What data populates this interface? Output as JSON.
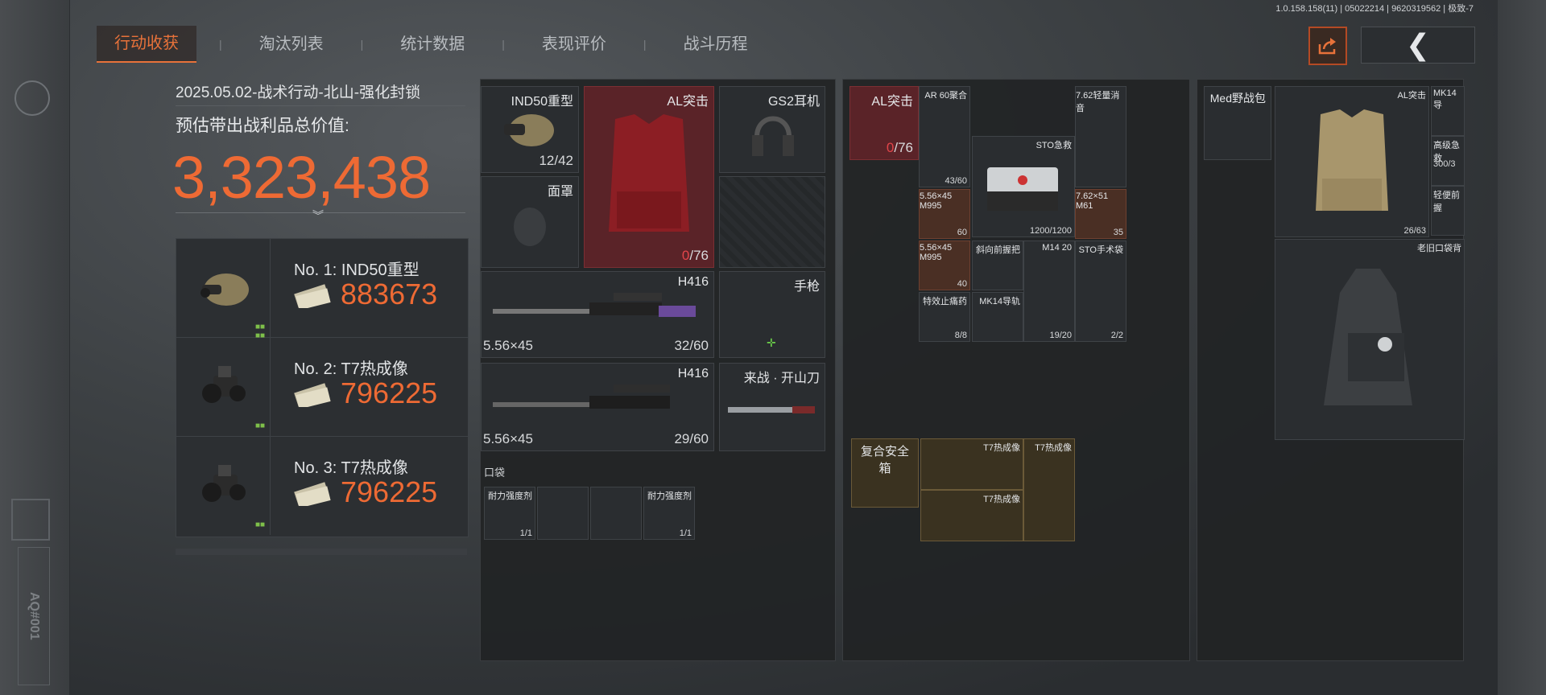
{
  "version_text": "1.0.158.158(11) | 05022214 | 9620319562 | 极致-7",
  "tabs": [
    {
      "label": "行动收获",
      "active": true
    },
    {
      "label": "淘汰列表",
      "active": false
    },
    {
      "label": "统计数据",
      "active": false
    },
    {
      "label": "表现评价",
      "active": false
    },
    {
      "label": "战斗历程",
      "active": false
    }
  ],
  "raid": {
    "info": "2025.05.02-战术行动-北山-强化封锁",
    "value_label": "预估带出战利品总价值:",
    "total_value": "3,323,438"
  },
  "top_items": [
    {
      "rank": "No. 1: IND50重型",
      "price": "883673",
      "icon": "helmet-icon"
    },
    {
      "rank": "No. 2: T7热成像",
      "price": "796225",
      "icon": "thermal-scope-icon"
    },
    {
      "rank": "No. 3: T7热成像",
      "price": "796225",
      "icon": "thermal-scope-icon"
    }
  ],
  "side_code": "AQ#001",
  "gear": {
    "helmet": {
      "label": "IND50重型",
      "count": "12/42"
    },
    "armor": {
      "label": "AL突击",
      "count_a": "0",
      "count_b": "/76"
    },
    "headset": {
      "label": "GS2耳机"
    },
    "mask": {
      "label": "面罩"
    },
    "primary1": {
      "label": "H416",
      "caliber": "5.56×45",
      "ammo": "32/60"
    },
    "pistol": {
      "label": "手枪"
    },
    "primary2": {
      "label": "H416",
      "caliber": "5.56×45",
      "ammo": "29/60"
    },
    "melee": {
      "label": "来战 · 开山刀"
    },
    "pocket_title": "口袋",
    "pockets": [
      {
        "label": "耐力强度剂",
        "count": "1/1"
      },
      {
        "label": "",
        "count": ""
      },
      {
        "label": "",
        "count": ""
      },
      {
        "label": "耐力强度剂",
        "count": "1/1"
      }
    ]
  },
  "rig": {
    "armor": {
      "label": "AL突击",
      "count_a": "0",
      "count_b": "/76"
    },
    "cells": [
      {
        "label": "AR 60聚合",
        "count": "43/60"
      },
      {
        "label": "7.62轻量消音",
        "count": ""
      },
      {
        "label": "STO急救",
        "count": "1200/1200"
      },
      {
        "label": "5.56×45 M995",
        "count": "60"
      },
      {
        "label": "7.62×51 M61",
        "count": "35"
      },
      {
        "label": "5.56×45 M995",
        "count": "40"
      },
      {
        "label": "斜向前握把",
        "count": ""
      },
      {
        "label": "M14 20",
        "count": "19/20"
      },
      {
        "label": "STO手术袋",
        "count": "2/2"
      },
      {
        "label": "特效止痛药",
        "count": "8/8"
      },
      {
        "label": "MK14导轨",
        "count": ""
      }
    ],
    "safe_box": {
      "label": "复合安全箱"
    },
    "safe_items": [
      {
        "label": "T7热成像"
      },
      {
        "label": "T7热成像"
      },
      {
        "label": "T7热成像"
      }
    ]
  },
  "backpack": {
    "bag": {
      "label": "Med野战包"
    },
    "armor": {
      "label": "AL突击",
      "count": "26/63"
    },
    "cells": [
      {
        "label": "MK14导"
      },
      {
        "label": "高级急救",
        "count": "300/3"
      },
      {
        "label": "轻便前握"
      }
    ],
    "old_bag": {
      "label": "老旧口袋背"
    }
  },
  "colors": {
    "accent": "#ee6a34",
    "panel": "#212325",
    "red_slot": "#5a2328",
    "gold_slot": "#3a3220"
  }
}
